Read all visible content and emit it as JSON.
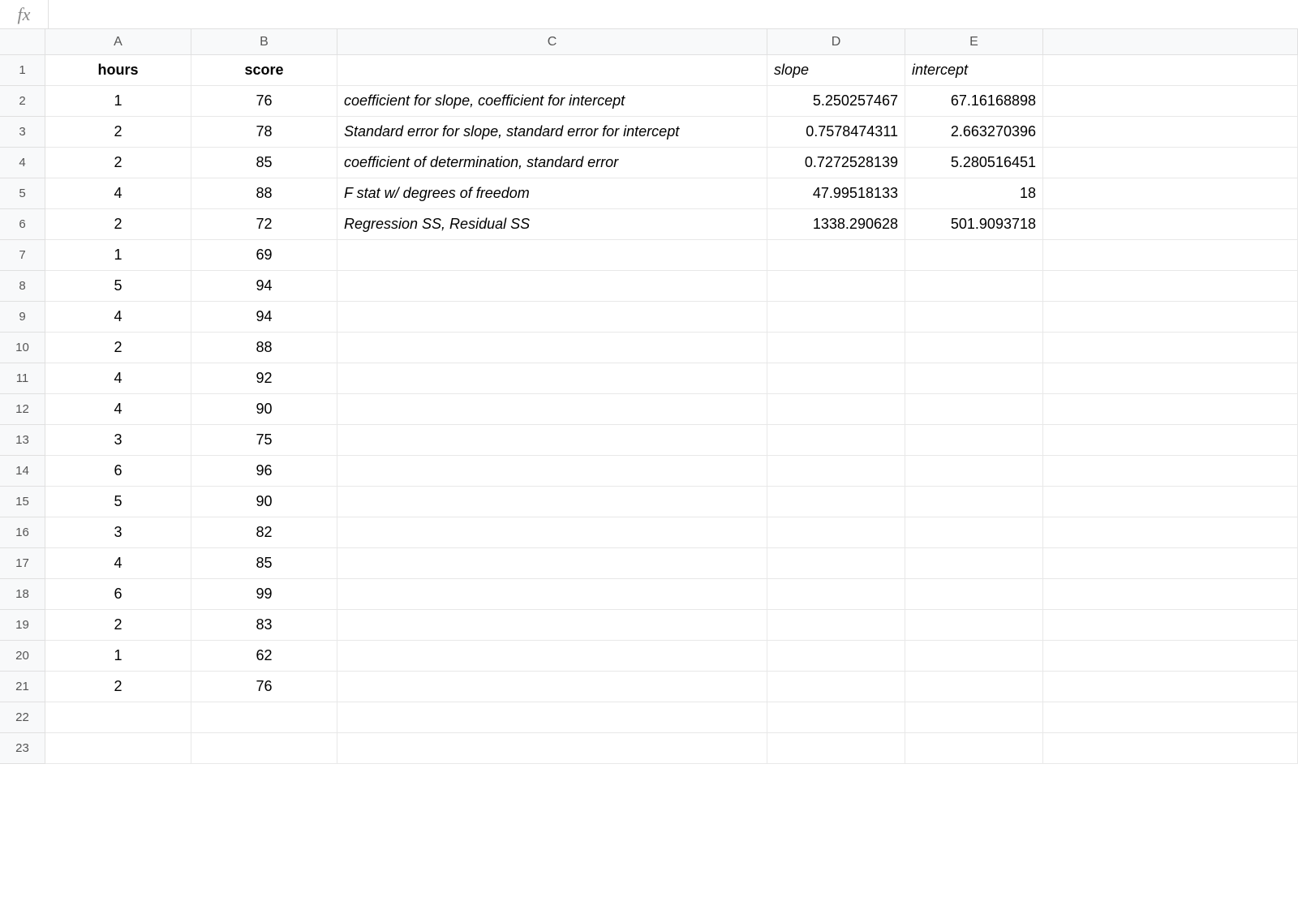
{
  "formula_bar": {
    "fx_label": "fx",
    "value": ""
  },
  "columns": [
    "A",
    "B",
    "C",
    "D",
    "E",
    ""
  ],
  "row_count": 23,
  "cells": {
    "A1": {
      "text": "hours",
      "bold": true,
      "align": "center"
    },
    "B1": {
      "text": "score",
      "bold": true,
      "align": "center"
    },
    "D1": {
      "text": "slope",
      "italic": true,
      "align": "left"
    },
    "E1": {
      "text": "intercept",
      "italic": true,
      "align": "left"
    },
    "A2": {
      "text": "1",
      "align": "center"
    },
    "B2": {
      "text": "76",
      "align": "center"
    },
    "C2": {
      "text": "coefficient for slope, coefficient for intercept",
      "italic": true,
      "align": "left"
    },
    "D2": {
      "text": "5.250257467",
      "align": "right"
    },
    "E2": {
      "text": "67.16168898",
      "align": "right"
    },
    "A3": {
      "text": "2",
      "align": "center"
    },
    "B3": {
      "text": "78",
      "align": "center"
    },
    "C3": {
      "text": "Standard error for slope, standard error for intercept",
      "italic": true,
      "align": "left"
    },
    "D3": {
      "text": "0.7578474311",
      "align": "right"
    },
    "E3": {
      "text": "2.663270396",
      "align": "right"
    },
    "A4": {
      "text": "2",
      "align": "center"
    },
    "B4": {
      "text": "85",
      "align": "center"
    },
    "C4": {
      "text": "coefficient of determination, standard error",
      "italic": true,
      "align": "left"
    },
    "D4": {
      "text": "0.7272528139",
      "align": "right"
    },
    "E4": {
      "text": "5.280516451",
      "align": "right"
    },
    "A5": {
      "text": "4",
      "align": "center"
    },
    "B5": {
      "text": "88",
      "align": "center"
    },
    "C5": {
      "text": "F stat w/ degrees of freedom",
      "italic": true,
      "align": "left"
    },
    "D5": {
      "text": "47.99518133",
      "align": "right"
    },
    "E5": {
      "text": "18",
      "align": "right"
    },
    "A6": {
      "text": "2",
      "align": "center"
    },
    "B6": {
      "text": "72",
      "align": "center"
    },
    "C6": {
      "text": "Regression SS, Residual SS",
      "italic": true,
      "align": "left"
    },
    "D6": {
      "text": "1338.290628",
      "align": "right"
    },
    "E6": {
      "text": "501.9093718",
      "align": "right"
    },
    "A7": {
      "text": "1",
      "align": "center"
    },
    "B7": {
      "text": "69",
      "align": "center"
    },
    "A8": {
      "text": "5",
      "align": "center"
    },
    "B8": {
      "text": "94",
      "align": "center"
    },
    "A9": {
      "text": "4",
      "align": "center"
    },
    "B9": {
      "text": "94",
      "align": "center"
    },
    "A10": {
      "text": "2",
      "align": "center"
    },
    "B10": {
      "text": "88",
      "align": "center"
    },
    "A11": {
      "text": "4",
      "align": "center"
    },
    "B11": {
      "text": "92",
      "align": "center"
    },
    "A12": {
      "text": "4",
      "align": "center"
    },
    "B12": {
      "text": "90",
      "align": "center"
    },
    "A13": {
      "text": "3",
      "align": "center"
    },
    "B13": {
      "text": "75",
      "align": "center"
    },
    "A14": {
      "text": "6",
      "align": "center"
    },
    "B14": {
      "text": "96",
      "align": "center"
    },
    "A15": {
      "text": "5",
      "align": "center"
    },
    "B15": {
      "text": "90",
      "align": "center"
    },
    "A16": {
      "text": "3",
      "align": "center"
    },
    "B16": {
      "text": "82",
      "align": "center"
    },
    "A17": {
      "text": "4",
      "align": "center"
    },
    "B17": {
      "text": "85",
      "align": "center"
    },
    "A18": {
      "text": "6",
      "align": "center"
    },
    "B18": {
      "text": "99",
      "align": "center"
    },
    "A19": {
      "text": "2",
      "align": "center"
    },
    "B19": {
      "text": "83",
      "align": "center"
    },
    "A20": {
      "text": "1",
      "align": "center"
    },
    "B20": {
      "text": "62",
      "align": "center"
    },
    "A21": {
      "text": "2",
      "align": "center"
    },
    "B21": {
      "text": "76",
      "align": "center"
    }
  }
}
